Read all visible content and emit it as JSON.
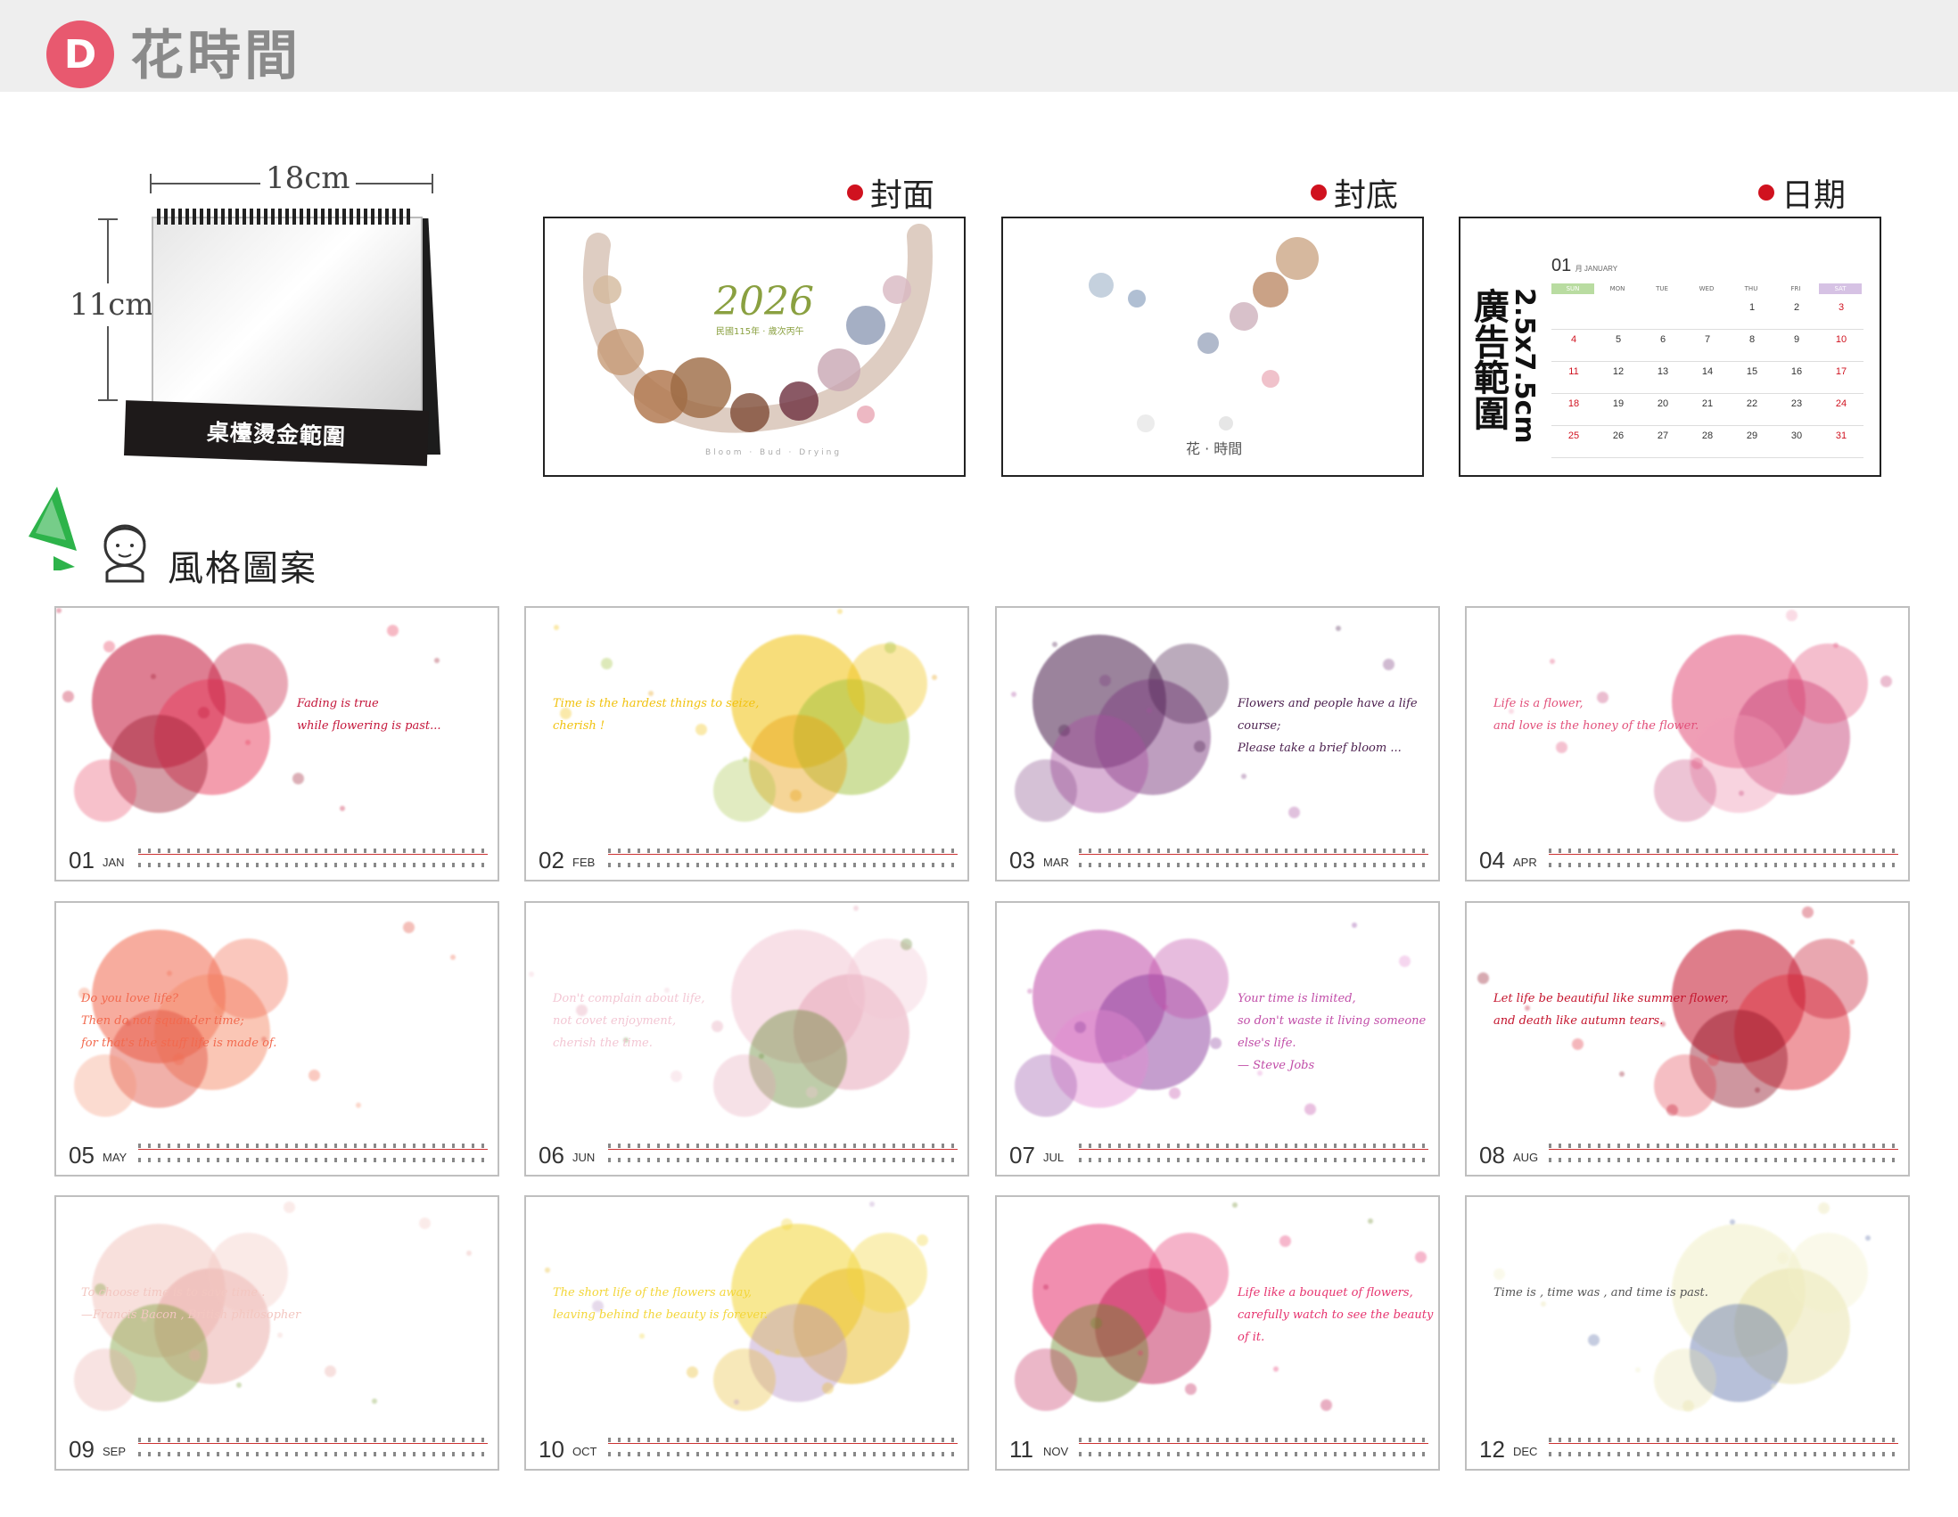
{
  "header": {
    "badge": "D",
    "title": "花時間"
  },
  "desk_mock": {
    "width_label": "18cm",
    "height_label": "11cm",
    "base_label": "桌檯燙金範圍"
  },
  "previews": {
    "cover": {
      "label": "封面",
      "year": "2026",
      "subtitle": "民國115年 · 歲次丙午",
      "tagline": "Bloom · Bud · Drying"
    },
    "back": {
      "label": "封底",
      "brand": "花 · 時間"
    },
    "date": {
      "label": "日期",
      "ad_label": "廣告範圍",
      "ad_size": "2.5x7.5cm",
      "month_num": "01",
      "month_name": "月 JANUARY",
      "weekdays": [
        "SUN",
        "MON",
        "TUE",
        "WED",
        "THU",
        "FRI",
        "SAT"
      ],
      "weeks": [
        [
          "",
          "",
          "",
          "",
          "1",
          "2",
          "3"
        ],
        [
          "4",
          "5",
          "6",
          "7",
          "8",
          "9",
          "10"
        ],
        [
          "11",
          "12",
          "13",
          "14",
          "15",
          "16",
          "17"
        ],
        [
          "18",
          "19",
          "20",
          "21",
          "22",
          "23",
          "24"
        ],
        [
          "25",
          "26",
          "27",
          "28",
          "29",
          "30",
          "31"
        ]
      ]
    }
  },
  "style_section": {
    "title": "風格圖案"
  },
  "months": [
    {
      "num": "01",
      "abbr": "JAN",
      "quote": [
        "Fading is true",
        "while flowering is past..."
      ],
      "colors": [
        "#c4163a",
        "#e8395a",
        "#9c1b30"
      ]
    },
    {
      "num": "02",
      "abbr": "FEB",
      "quote": [
        "Time is the hardest things to seize,",
        "cherish !"
      ],
      "colors": [
        "#f1c20f",
        "#9fc23a",
        "#e8a010"
      ]
    },
    {
      "num": "03",
      "abbr": "MAR",
      "quote": [
        "Flowers and people have a life course;",
        "Please take a brief bloom ..."
      ],
      "colors": [
        "#4a1e4d",
        "#7b3b7e",
        "#a84fa0"
      ]
    },
    {
      "num": "04",
      "abbr": "APR",
      "quote": [
        "Life is a flower,",
        "and love is the honey of the flower."
      ],
      "colors": [
        "#e2507a",
        "#c7457a",
        "#f19bb6"
      ]
    },
    {
      "num": "05",
      "abbr": "MAY",
      "quote": [
        "Do you love life?",
        "Then do not squander time;",
        "for that's the stuff life is made of."
      ],
      "colors": [
        "#f26a4f",
        "#f58c6a",
        "#e04a3a"
      ]
    },
    {
      "num": "06",
      "abbr": "JUN",
      "quote": [
        "Don't complain about life,",
        "not covet enjoyment,",
        "cherish the time."
      ],
      "colors": [
        "#f3c7d4",
        "#e59fb3",
        "#6b8a3a"
      ]
    },
    {
      "num": "07",
      "abbr": "JUL",
      "quote": [
        "Your time is limited,",
        "so don't waste it living someone else's life.",
        "— Steve Jobs"
      ],
      "colors": [
        "#c14da8",
        "#8a3b9c",
        "#e48bd2"
      ]
    },
    {
      "num": "08",
      "abbr": "AUG",
      "quote": [
        "Let life be beautiful like summer flower,",
        "and death like autumn tears."
      ],
      "colors": [
        "#c4132c",
        "#e0323f",
        "#8e0f22"
      ]
    },
    {
      "num": "09",
      "abbr": "SEP",
      "quote": [
        "To choose time is to save time .",
        "—Francis Bacon , British philosopher"
      ],
      "colors": [
        "#f3c7c1",
        "#e9a7a3",
        "#7da03a"
      ]
    },
    {
      "num": "10",
      "abbr": "OCT",
      "quote": [
        "The short life of the flowers away,",
        "leaving behind the beauty is forever."
      ],
      "colors": [
        "#f3d63a",
        "#e8b81f",
        "#b996c8"
      ]
    },
    {
      "num": "11",
      "abbr": "NOV",
      "quote": [
        "Life like a bouquet of flowers,",
        "carefully watch to see the beauty of it."
      ],
      "colors": [
        "#e6336e",
        "#c01a52",
        "#6b8a2a"
      ]
    },
    {
      "num": "12",
      "abbr": "DEC",
      "quote": [
        "Time is , time was , and time is past."
      ],
      "colors": [
        "#f2f0c8",
        "#e8e2a6",
        "#5b6fa8"
      ]
    }
  ]
}
